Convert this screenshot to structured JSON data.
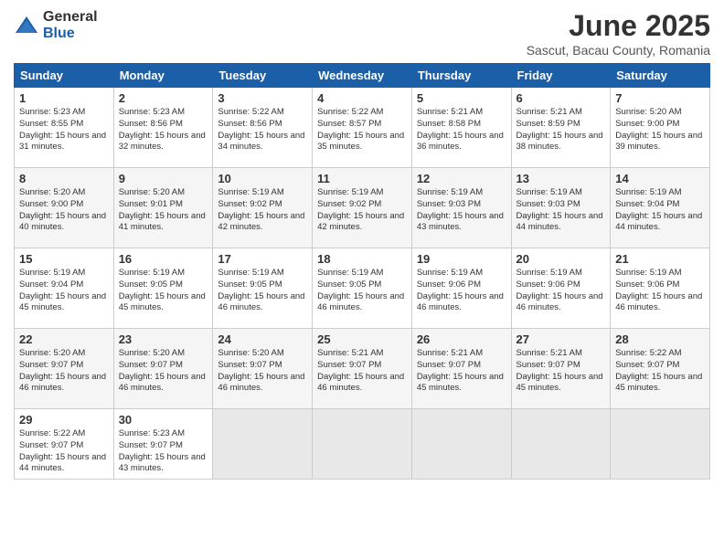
{
  "header": {
    "logo": {
      "general": "General",
      "blue": "Blue"
    },
    "title": "June 2025",
    "subtitle": "Sascut, Bacau County, Romania"
  },
  "calendar": {
    "days_of_week": [
      "Sunday",
      "Monday",
      "Tuesday",
      "Wednesday",
      "Thursday",
      "Friday",
      "Saturday"
    ],
    "weeks": [
      [
        {
          "day": "",
          "empty": true
        },
        {
          "day": "",
          "empty": true
        },
        {
          "day": "",
          "empty": true
        },
        {
          "day": "",
          "empty": true
        },
        {
          "day": "",
          "empty": true
        },
        {
          "day": "",
          "empty": true
        },
        {
          "day": "",
          "empty": true
        }
      ],
      [
        {
          "day": "1",
          "sunrise": "5:23 AM",
          "sunset": "8:55 PM",
          "daylight": "15 hours and 31 minutes."
        },
        {
          "day": "2",
          "sunrise": "5:23 AM",
          "sunset": "8:56 PM",
          "daylight": "15 hours and 32 minutes."
        },
        {
          "day": "3",
          "sunrise": "5:22 AM",
          "sunset": "8:56 PM",
          "daylight": "15 hours and 34 minutes."
        },
        {
          "day": "4",
          "sunrise": "5:22 AM",
          "sunset": "8:57 PM",
          "daylight": "15 hours and 35 minutes."
        },
        {
          "day": "5",
          "sunrise": "5:21 AM",
          "sunset": "8:58 PM",
          "daylight": "15 hours and 36 minutes."
        },
        {
          "day": "6",
          "sunrise": "5:21 AM",
          "sunset": "8:59 PM",
          "daylight": "15 hours and 38 minutes."
        },
        {
          "day": "7",
          "sunrise": "5:20 AM",
          "sunset": "9:00 PM",
          "daylight": "15 hours and 39 minutes."
        }
      ],
      [
        {
          "day": "8",
          "sunrise": "5:20 AM",
          "sunset": "9:00 PM",
          "daylight": "15 hours and 40 minutes."
        },
        {
          "day": "9",
          "sunrise": "5:20 AM",
          "sunset": "9:01 PM",
          "daylight": "15 hours and 41 minutes."
        },
        {
          "day": "10",
          "sunrise": "5:19 AM",
          "sunset": "9:02 PM",
          "daylight": "15 hours and 42 minutes."
        },
        {
          "day": "11",
          "sunrise": "5:19 AM",
          "sunset": "9:02 PM",
          "daylight": "15 hours and 42 minutes."
        },
        {
          "day": "12",
          "sunrise": "5:19 AM",
          "sunset": "9:03 PM",
          "daylight": "15 hours and 43 minutes."
        },
        {
          "day": "13",
          "sunrise": "5:19 AM",
          "sunset": "9:03 PM",
          "daylight": "15 hours and 44 minutes."
        },
        {
          "day": "14",
          "sunrise": "5:19 AM",
          "sunset": "9:04 PM",
          "daylight": "15 hours and 44 minutes."
        }
      ],
      [
        {
          "day": "15",
          "sunrise": "5:19 AM",
          "sunset": "9:04 PM",
          "daylight": "15 hours and 45 minutes."
        },
        {
          "day": "16",
          "sunrise": "5:19 AM",
          "sunset": "9:05 PM",
          "daylight": "15 hours and 45 minutes."
        },
        {
          "day": "17",
          "sunrise": "5:19 AM",
          "sunset": "9:05 PM",
          "daylight": "15 hours and 46 minutes."
        },
        {
          "day": "18",
          "sunrise": "5:19 AM",
          "sunset": "9:05 PM",
          "daylight": "15 hours and 46 minutes."
        },
        {
          "day": "19",
          "sunrise": "5:19 AM",
          "sunset": "9:06 PM",
          "daylight": "15 hours and 46 minutes."
        },
        {
          "day": "20",
          "sunrise": "5:19 AM",
          "sunset": "9:06 PM",
          "daylight": "15 hours and 46 minutes."
        },
        {
          "day": "21",
          "sunrise": "5:19 AM",
          "sunset": "9:06 PM",
          "daylight": "15 hours and 46 minutes."
        }
      ],
      [
        {
          "day": "22",
          "sunrise": "5:20 AM",
          "sunset": "9:07 PM",
          "daylight": "15 hours and 46 minutes."
        },
        {
          "day": "23",
          "sunrise": "5:20 AM",
          "sunset": "9:07 PM",
          "daylight": "15 hours and 46 minutes."
        },
        {
          "day": "24",
          "sunrise": "5:20 AM",
          "sunset": "9:07 PM",
          "daylight": "15 hours and 46 minutes."
        },
        {
          "day": "25",
          "sunrise": "5:21 AM",
          "sunset": "9:07 PM",
          "daylight": "15 hours and 46 minutes."
        },
        {
          "day": "26",
          "sunrise": "5:21 AM",
          "sunset": "9:07 PM",
          "daylight": "15 hours and 45 minutes."
        },
        {
          "day": "27",
          "sunrise": "5:21 AM",
          "sunset": "9:07 PM",
          "daylight": "15 hours and 45 minutes."
        },
        {
          "day": "28",
          "sunrise": "5:22 AM",
          "sunset": "9:07 PM",
          "daylight": "15 hours and 45 minutes."
        }
      ],
      [
        {
          "day": "29",
          "sunrise": "5:22 AM",
          "sunset": "9:07 PM",
          "daylight": "15 hours and 44 minutes."
        },
        {
          "day": "30",
          "sunrise": "5:23 AM",
          "sunset": "9:07 PM",
          "daylight": "15 hours and 43 minutes."
        },
        {
          "day": "",
          "empty": true
        },
        {
          "day": "",
          "empty": true
        },
        {
          "day": "",
          "empty": true
        },
        {
          "day": "",
          "empty": true
        },
        {
          "day": "",
          "empty": true
        }
      ]
    ]
  }
}
